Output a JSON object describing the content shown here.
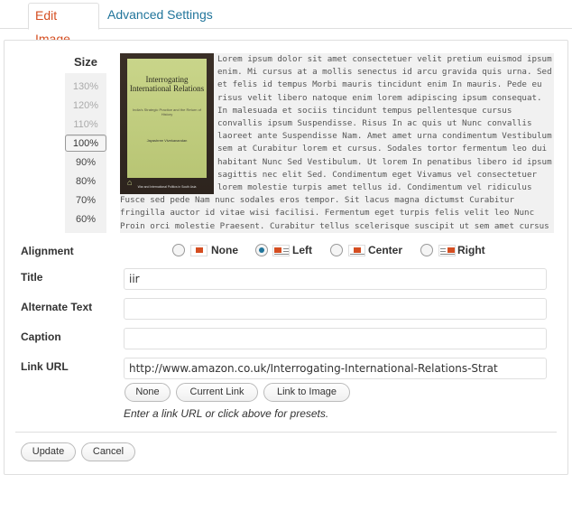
{
  "tabs": {
    "edit_image": "Edit Image",
    "advanced_settings": "Advanced Settings"
  },
  "size": {
    "label": "Size",
    "options": [
      "130%",
      "120%",
      "110%",
      "100%",
      "90%",
      "80%",
      "70%",
      "60%"
    ],
    "selected": "100%"
  },
  "preview": {
    "book": {
      "title": "Interrogating International Relations",
      "subtitle": "India's Strategic Practice and the Return of History",
      "author": "Jayashree Vivekanandan",
      "series": "War and International Politics in South Asia"
    },
    "lorem": "Lorem ipsum dolor sit amet consectetuer velit pretium euismod ipsum enim. Mi cursus at a mollis senectus id arcu gravida quis urna. Sed et felis id tempus Morbi mauris tincidunt enim In mauris. Pede eu risus velit libero natoque enim lorem adipiscing ipsum consequat. In malesuada et sociis tincidunt tempus pellentesque cursus convallis ipsum Suspendisse. Risus In ac quis ut Nunc convallis laoreet ante Suspendisse Nam. Amet amet urna condimentum Vestibulum sem at Curabitur lorem et cursus. Sodales tortor fermentum leo dui habitant Nunc Sed Vestibulum. Ut lorem In penatibus libero id ipsum sagittis nec elit Sed. Condimentum eget Vivamus vel consectetuer lorem molestie turpis amet tellus id. Condimentum vel ridiculus Fusce sed pede Nam nunc sodales eros tempor. Sit lacus magna dictumst Curabitur fringilla auctor id vitae wisi facilisi. Fermentum eget turpis felis velit leo Nunc Proin orci molestie Praesent. Curabitur tellus scelerisque suscipit ut sem amet cursus mi Morbi eu. Donec libero Vestibulum augue et mollis accumsan pretium In sem. Leo est ac consectetuer quis condimentum."
  },
  "alignment": {
    "label": "Alignment",
    "options": [
      "None",
      "Left",
      "Center",
      "Right"
    ],
    "selected": "Left"
  },
  "fields": {
    "title_label": "Title",
    "title_value": "iir",
    "alt_label": "Alternate Text",
    "alt_value": "",
    "caption_label": "Caption",
    "caption_value": "",
    "link_label": "Link URL",
    "link_value": "http://www.amazon.co.uk/Interrogating-International-Relations-Strat"
  },
  "link_buttons": {
    "none": "None",
    "current": "Current Link",
    "image": "Link to Image"
  },
  "hint": "Enter a link URL or click above for presets.",
  "actions": {
    "update": "Update",
    "cancel": "Cancel"
  },
  "colors": {
    "active_tab": "#d54e21",
    "link": "#21759b",
    "border": "#dfdfdf"
  }
}
